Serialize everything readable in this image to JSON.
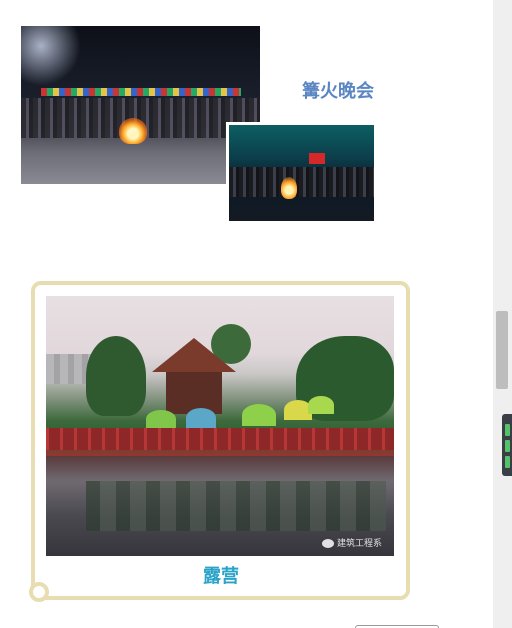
{
  "bonfire": {
    "title": "篝火晚会",
    "title_color": "#5a86c2"
  },
  "camping": {
    "title": "露营",
    "title_color": "#2aa3c8",
    "watermark": "建筑工程系",
    "frame_color": "#e8ddb0"
  },
  "icons": {
    "watermark_icon": "wechat-icon"
  }
}
